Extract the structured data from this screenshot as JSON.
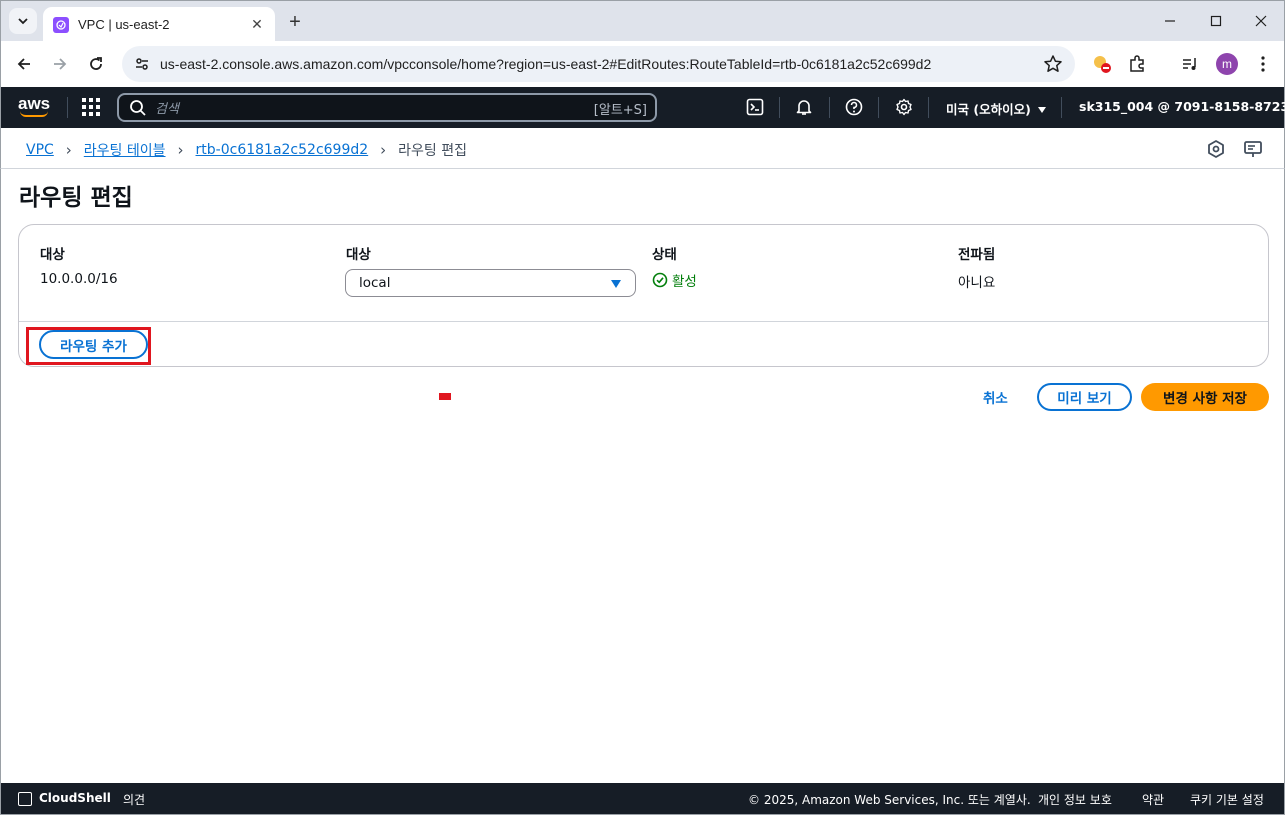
{
  "browser": {
    "tab_title": "VPC | us-east-2",
    "url": "us-east-2.console.aws.amazon.com/vpcconsole/home?region=us-east-2#EditRoutes:RouteTableId=rtb-0c6181a2c52c699d2",
    "profile_initial": "m",
    "new_tab": "+"
  },
  "aws_nav": {
    "logo": "aws",
    "search_placeholder": "검색",
    "search_shortcut": "[알트+S]",
    "region": "미국 (오하이오)",
    "account": "sk315_004 @ 7091-8158-8723"
  },
  "breadcrumb": {
    "items": [
      "VPC",
      "라우팅 테이블",
      "rtb-0c6181a2c52c699d2"
    ],
    "current": "라우팅 편집"
  },
  "page": {
    "title": "라우팅 편집",
    "columns": {
      "destination": "대상",
      "target": "대상",
      "status": "상태",
      "propagated": "전파됨"
    },
    "route": {
      "destination": "10.0.0.0/16",
      "target": "local",
      "status": "활성",
      "propagated": "아니요"
    },
    "add_route": "라우팅 추가",
    "cancel": "취소",
    "preview": "미리 보기",
    "save": "변경 사항 저장"
  },
  "footer": {
    "cloudshell": "CloudShell",
    "feedback": "의견",
    "copyright": "© 2025, Amazon Web Services, Inc. 또는 계열사.",
    "privacy": "개인 정보 보호",
    "terms": "약관",
    "cookies": "쿠키 기본 설정"
  },
  "colors": {
    "accent": "#0972d3",
    "primary_button": "#ff9900",
    "success": "#037f0c",
    "nav_bg": "#161d26",
    "highlight": "#e0161f"
  }
}
